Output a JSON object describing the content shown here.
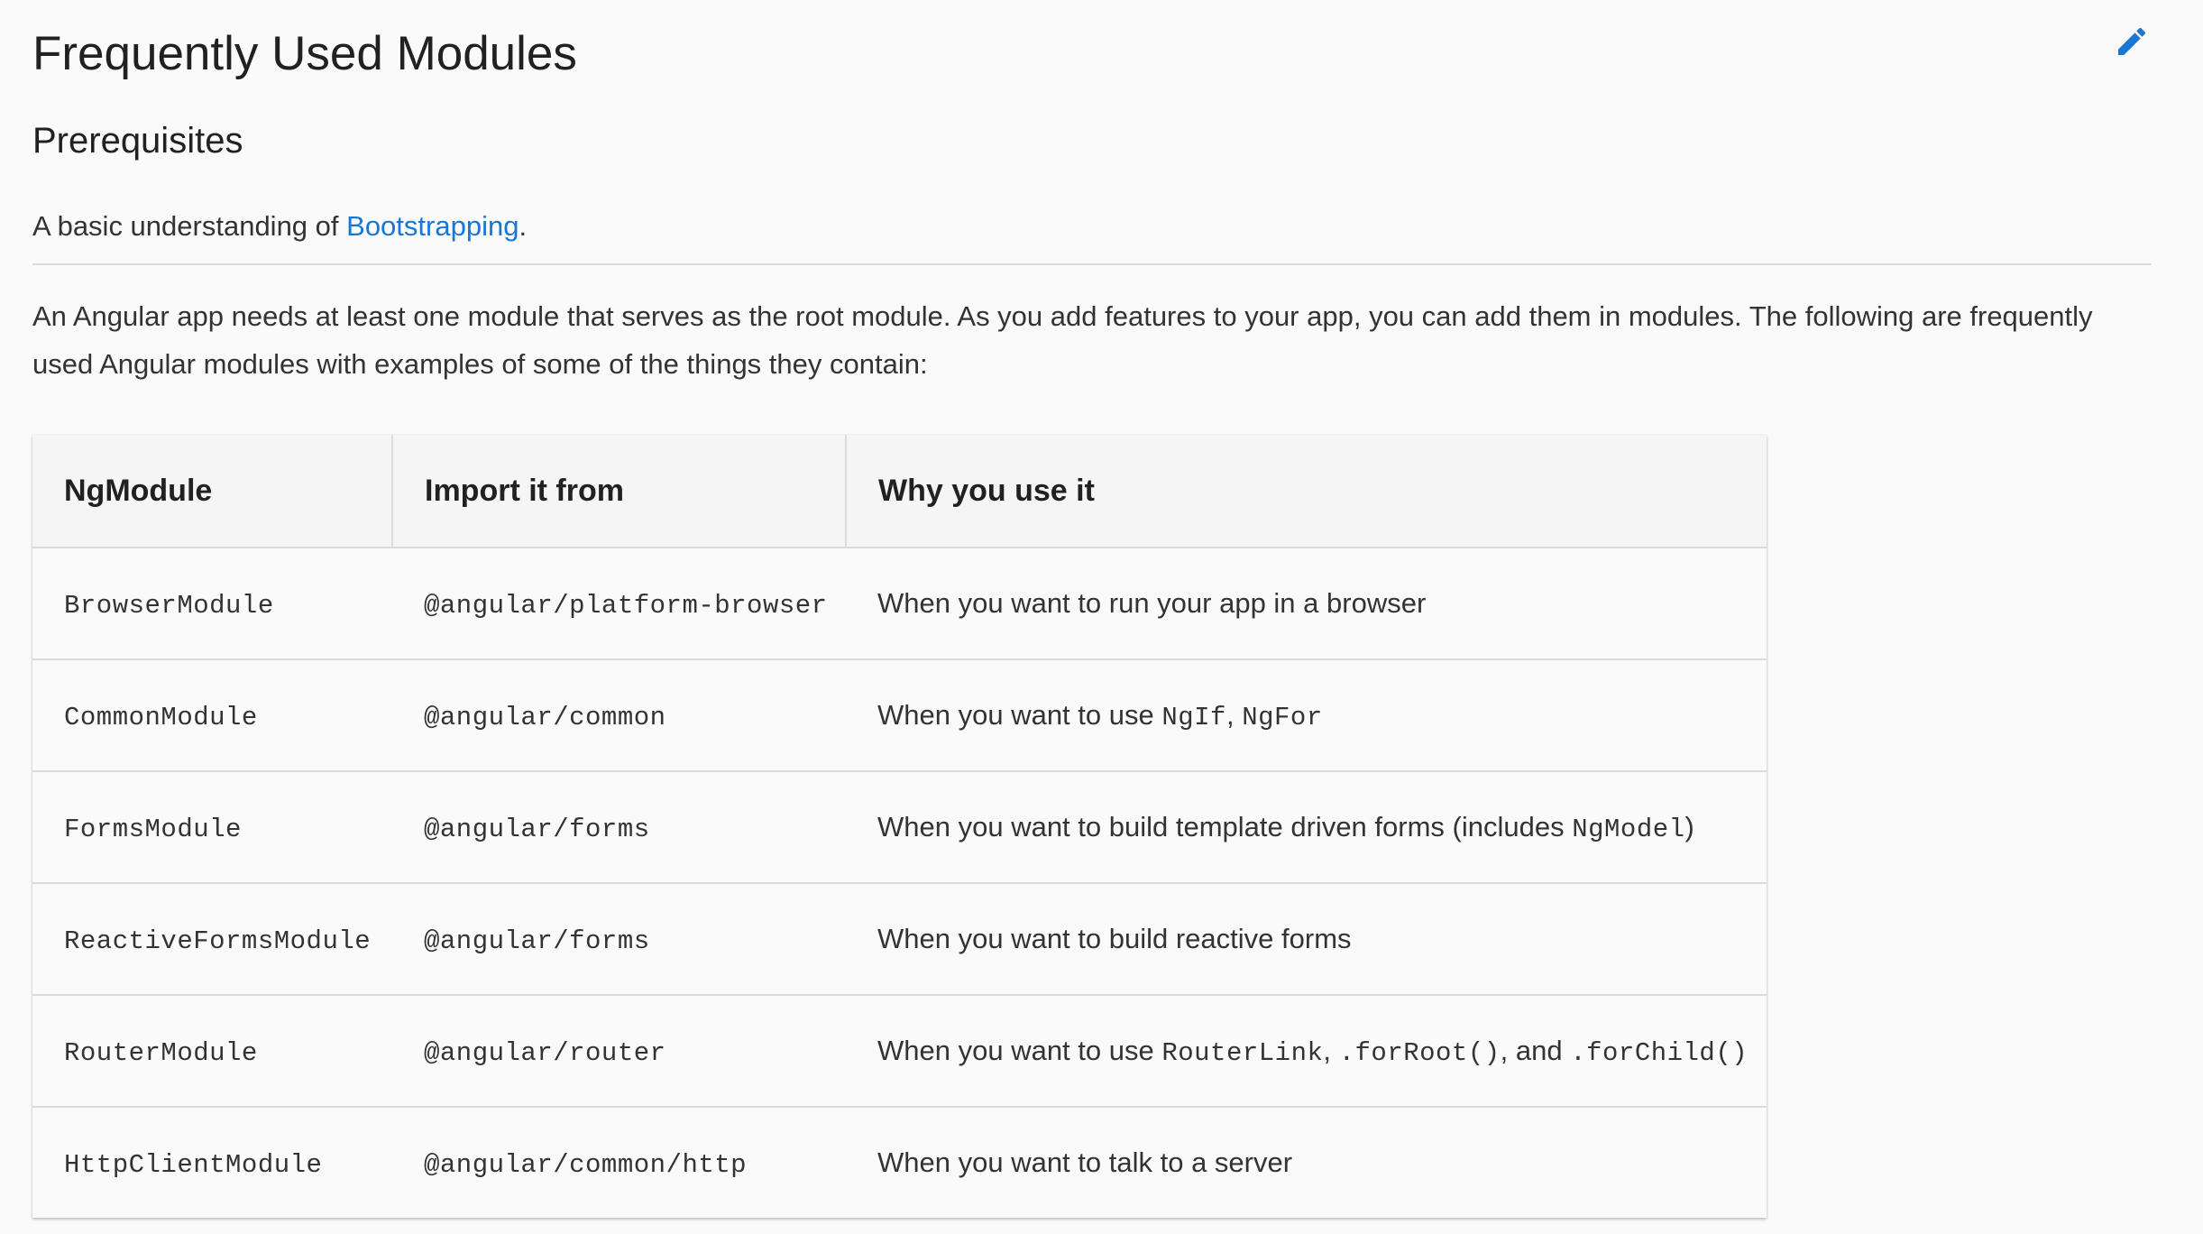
{
  "page": {
    "title": "Frequently Used Modules",
    "edit_icon": "pencil-icon",
    "accent_color": "#1976d2"
  },
  "prerequisites": {
    "heading": "Prerequisites",
    "text_before": "A basic understanding of ",
    "link_text": "Bootstrapping",
    "text_after": "."
  },
  "intro": "An Angular app needs at least one module that serves as the root module. As you add features to your app, you can add them in modules. The following are frequently used Angular modules with examples of some of the things they contain:",
  "table": {
    "headers": [
      "NgModule",
      "Import it from",
      "Why you use it"
    ],
    "rows": [
      {
        "module": "BrowserModule",
        "import_from": "@angular/platform-browser",
        "why": "When you want to run your app in a browser"
      },
      {
        "module": "CommonModule",
        "import_from": "@angular/common",
        "why_text": "When you want to use ",
        "why_code1": "NgIf",
        "why_sep1": ", ",
        "why_code2": "NgFor"
      },
      {
        "module": "FormsModule",
        "import_from": "@angular/forms",
        "why_text": "When you want to build template driven forms (includes ",
        "why_code1": "NgModel",
        "why_end": ")"
      },
      {
        "module": "ReactiveFormsModule",
        "import_from": "@angular/forms",
        "why": "When you want to build reactive forms"
      },
      {
        "module": "RouterModule",
        "import_from": "@angular/router",
        "why_text": "When you want to use ",
        "why_code1": "RouterLink",
        "why_sep1": ", ",
        "why_code2": ".forRoot()",
        "why_sep2": ", and ",
        "why_code3": ".forChild()"
      },
      {
        "module": "HttpClientModule",
        "import_from": "@angular/common/http",
        "why": "When you want to talk to a server"
      }
    ]
  }
}
